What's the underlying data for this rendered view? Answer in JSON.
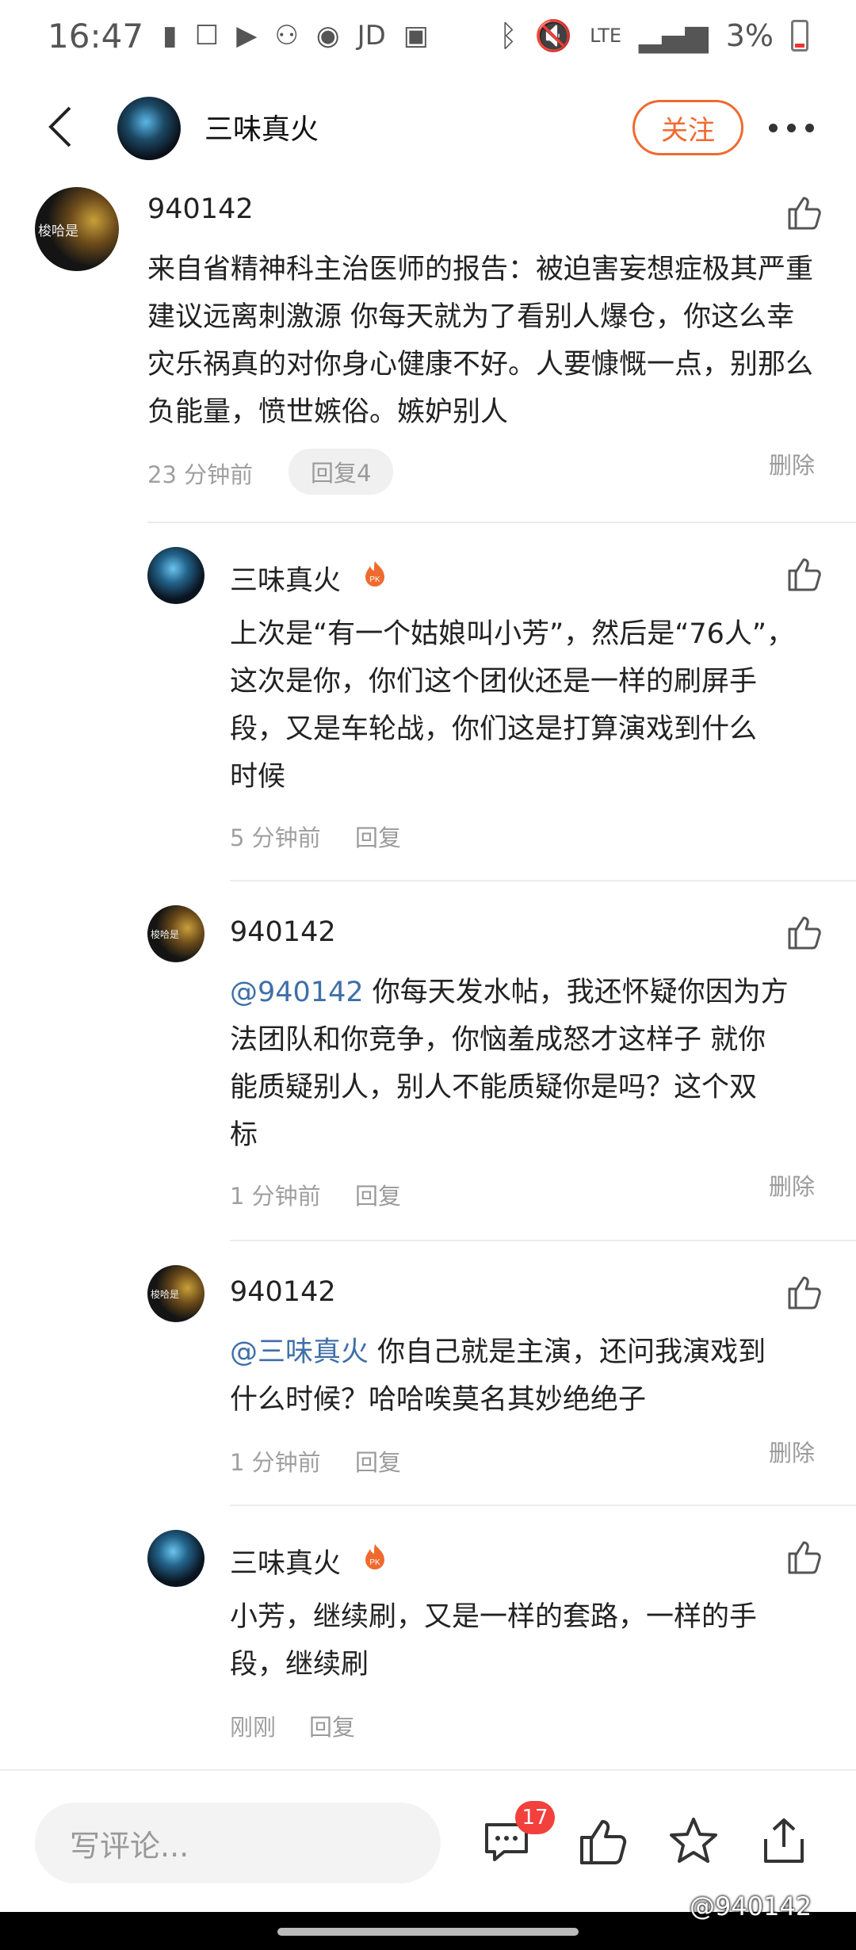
{
  "status_bar": {
    "time": "16:47",
    "jd_label": "JD",
    "lte_label": "LTE",
    "battery": "3%"
  },
  "header": {
    "title": "三味真火",
    "follow_label": "关注"
  },
  "comment": {
    "username": "940142",
    "avatar_text": "梭哈是",
    "text": "来自省精神科主治医师的报告：被迫害妄想症极其严重 建议远离刺激源 你每天就为了看别人爆仓，你这么幸灾乐祸真的对你身心健康不好。人要慷慨一点，别那么负能量，愤世嫉俗。嫉妒别人",
    "time": "23 分钟前",
    "reply_label": "回复4",
    "delete_label": "删除"
  },
  "replies": [
    {
      "username": "三味真火",
      "lines": [
        "上次是“有一个姑娘叫小芳”，然后是“76人”，",
        "这次是你，你们这个团伙还是一样的刷屏手",
        "段，又是车轮战，你们这是打算演戏到什么",
        "时候"
      ],
      "time": "5 分钟前",
      "reply_label": "回复"
    },
    {
      "username": "940142",
      "avatar_text": "梭哈是",
      "mention": "@940142",
      "lines": [
        " 你每天发水帖，我还怀疑你因为方",
        "法团队和你竞争，你恼羞成怒才这样子 就你",
        "能质疑别人，别人不能质疑你是吗？这个双",
        "标"
      ],
      "time": "1 分钟前",
      "reply_label": "回复",
      "delete_label": "删除"
    },
    {
      "username": "940142",
      "avatar_text": "梭哈是",
      "mention": "@三味真火",
      "lines": [
        " 你自己就是主演，还问我演戏到",
        "什么时候？哈哈唉莫名其妙绝绝子"
      ],
      "time": "1 分钟前",
      "reply_label": "回复",
      "delete_label": "删除"
    },
    {
      "username": "三味真火",
      "lines": [
        "小芳，继续刷，又是一样的套路，一样的手",
        "段，继续刷"
      ],
      "time": "刚刚",
      "reply_label": "回复"
    }
  ],
  "bottom_bar": {
    "input_placeholder": "写评论...",
    "comment_count": "17"
  },
  "watermark": "@940142",
  "colors": {
    "accent": "#f06a2f",
    "mention": "#3f6fa8",
    "badge": "#f2403c"
  }
}
